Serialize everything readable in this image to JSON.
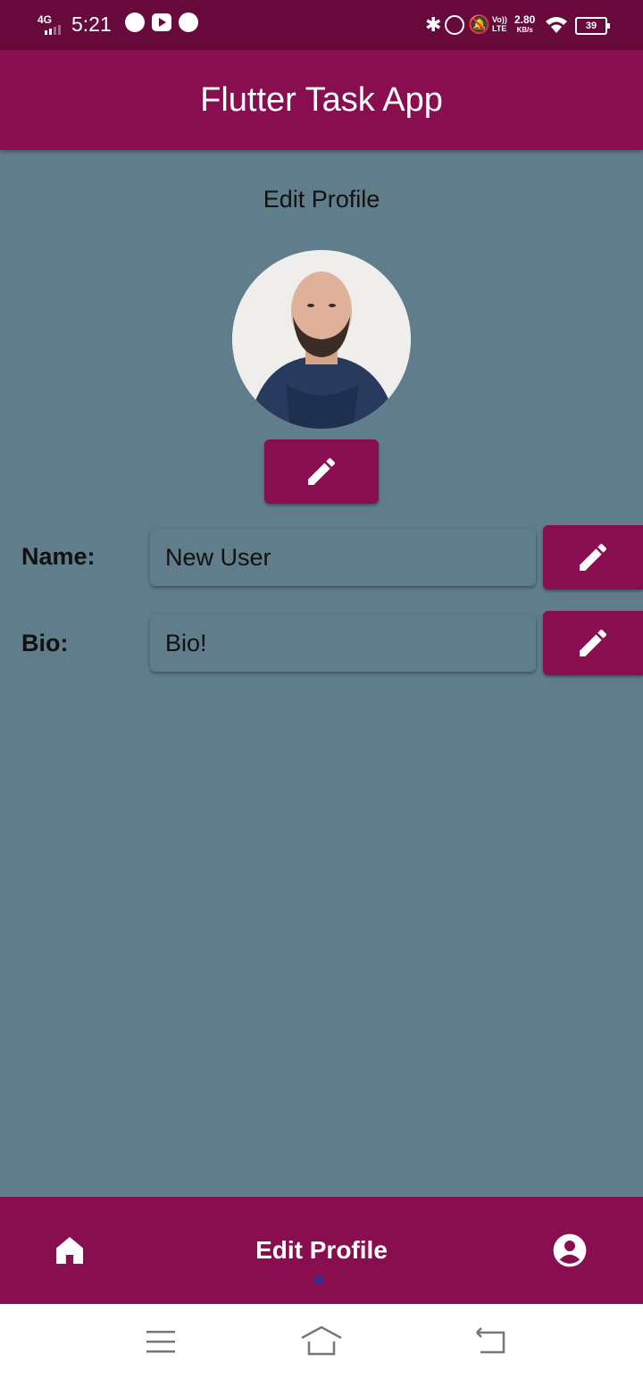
{
  "status_bar": {
    "network": "4G",
    "time": "5:21",
    "volte": "Vo)) LTE",
    "speed": "2.80",
    "speed_unit": "KB/s",
    "battery": "39"
  },
  "app_bar": {
    "title": "Flutter Task App"
  },
  "profile": {
    "heading": "Edit Profile",
    "avatar_icon": "profile-photo",
    "name_label": "Name:",
    "name_value": "New User",
    "bio_label": "Bio:",
    "bio_value": "Bio!",
    "edit_icon": "pencil-icon"
  },
  "bottom_nav": {
    "items": [
      {
        "icon": "home-icon"
      },
      {
        "label": "Edit Profile",
        "selected": true
      },
      {
        "icon": "account-circle-icon"
      }
    ],
    "indicator_color": "#283593"
  },
  "system_nav": {
    "buttons": [
      "menu",
      "home",
      "back"
    ]
  },
  "colors": {
    "status_bar": "#68093c",
    "primary": "#880e4f",
    "background": "#607d8b",
    "text": "#111111"
  }
}
